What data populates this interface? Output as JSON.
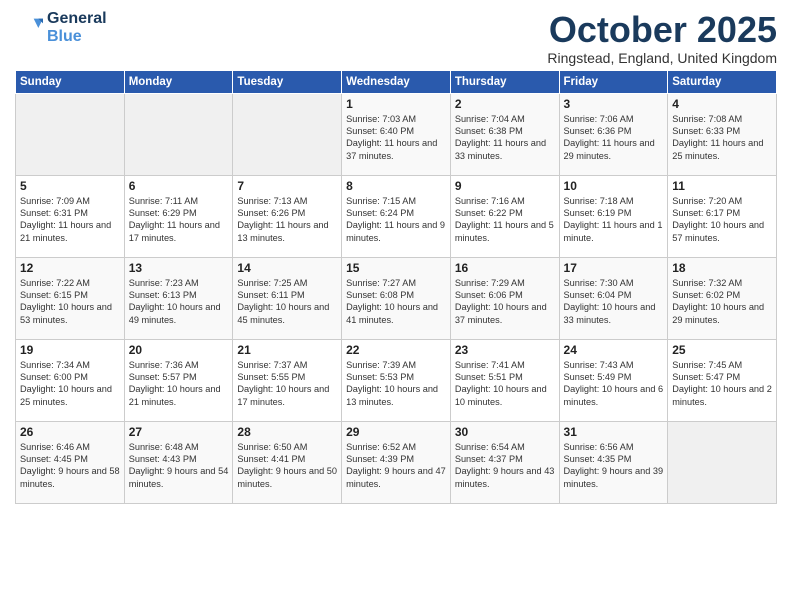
{
  "logo": {
    "line1": "General",
    "line2": "Blue"
  },
  "title": "October 2025",
  "location": "Ringstead, England, United Kingdom",
  "days_of_week": [
    "Sunday",
    "Monday",
    "Tuesday",
    "Wednesday",
    "Thursday",
    "Friday",
    "Saturday"
  ],
  "weeks": [
    [
      {
        "day": "",
        "empty": true
      },
      {
        "day": "",
        "empty": true
      },
      {
        "day": "",
        "empty": true
      },
      {
        "day": "1",
        "sunrise": "7:03 AM",
        "sunset": "6:40 PM",
        "daylight": "11 hours and 37 minutes."
      },
      {
        "day": "2",
        "sunrise": "7:04 AM",
        "sunset": "6:38 PM",
        "daylight": "11 hours and 33 minutes."
      },
      {
        "day": "3",
        "sunrise": "7:06 AM",
        "sunset": "6:36 PM",
        "daylight": "11 hours and 29 minutes."
      },
      {
        "day": "4",
        "sunrise": "7:08 AM",
        "sunset": "6:33 PM",
        "daylight": "11 hours and 25 minutes."
      }
    ],
    [
      {
        "day": "5",
        "sunrise": "7:09 AM",
        "sunset": "6:31 PM",
        "daylight": "11 hours and 21 minutes."
      },
      {
        "day": "6",
        "sunrise": "7:11 AM",
        "sunset": "6:29 PM",
        "daylight": "11 hours and 17 minutes."
      },
      {
        "day": "7",
        "sunrise": "7:13 AM",
        "sunset": "6:26 PM",
        "daylight": "11 hours and 13 minutes."
      },
      {
        "day": "8",
        "sunrise": "7:15 AM",
        "sunset": "6:24 PM",
        "daylight": "11 hours and 9 minutes."
      },
      {
        "day": "9",
        "sunrise": "7:16 AM",
        "sunset": "6:22 PM",
        "daylight": "11 hours and 5 minutes."
      },
      {
        "day": "10",
        "sunrise": "7:18 AM",
        "sunset": "6:19 PM",
        "daylight": "11 hours and 1 minute."
      },
      {
        "day": "11",
        "sunrise": "7:20 AM",
        "sunset": "6:17 PM",
        "daylight": "10 hours and 57 minutes."
      }
    ],
    [
      {
        "day": "12",
        "sunrise": "7:22 AM",
        "sunset": "6:15 PM",
        "daylight": "10 hours and 53 minutes."
      },
      {
        "day": "13",
        "sunrise": "7:23 AM",
        "sunset": "6:13 PM",
        "daylight": "10 hours and 49 minutes."
      },
      {
        "day": "14",
        "sunrise": "7:25 AM",
        "sunset": "6:11 PM",
        "daylight": "10 hours and 45 minutes."
      },
      {
        "day": "15",
        "sunrise": "7:27 AM",
        "sunset": "6:08 PM",
        "daylight": "10 hours and 41 minutes."
      },
      {
        "day": "16",
        "sunrise": "7:29 AM",
        "sunset": "6:06 PM",
        "daylight": "10 hours and 37 minutes."
      },
      {
        "day": "17",
        "sunrise": "7:30 AM",
        "sunset": "6:04 PM",
        "daylight": "10 hours and 33 minutes."
      },
      {
        "day": "18",
        "sunrise": "7:32 AM",
        "sunset": "6:02 PM",
        "daylight": "10 hours and 29 minutes."
      }
    ],
    [
      {
        "day": "19",
        "sunrise": "7:34 AM",
        "sunset": "6:00 PM",
        "daylight": "10 hours and 25 minutes."
      },
      {
        "day": "20",
        "sunrise": "7:36 AM",
        "sunset": "5:57 PM",
        "daylight": "10 hours and 21 minutes."
      },
      {
        "day": "21",
        "sunrise": "7:37 AM",
        "sunset": "5:55 PM",
        "daylight": "10 hours and 17 minutes."
      },
      {
        "day": "22",
        "sunrise": "7:39 AM",
        "sunset": "5:53 PM",
        "daylight": "10 hours and 13 minutes."
      },
      {
        "day": "23",
        "sunrise": "7:41 AM",
        "sunset": "5:51 PM",
        "daylight": "10 hours and 10 minutes."
      },
      {
        "day": "24",
        "sunrise": "7:43 AM",
        "sunset": "5:49 PM",
        "daylight": "10 hours and 6 minutes."
      },
      {
        "day": "25",
        "sunrise": "7:45 AM",
        "sunset": "5:47 PM",
        "daylight": "10 hours and 2 minutes."
      }
    ],
    [
      {
        "day": "26",
        "sunrise": "6:46 AM",
        "sunset": "4:45 PM",
        "daylight": "9 hours and 58 minutes."
      },
      {
        "day": "27",
        "sunrise": "6:48 AM",
        "sunset": "4:43 PM",
        "daylight": "9 hours and 54 minutes."
      },
      {
        "day": "28",
        "sunrise": "6:50 AM",
        "sunset": "4:41 PM",
        "daylight": "9 hours and 50 minutes."
      },
      {
        "day": "29",
        "sunrise": "6:52 AM",
        "sunset": "4:39 PM",
        "daylight": "9 hours and 47 minutes."
      },
      {
        "day": "30",
        "sunrise": "6:54 AM",
        "sunset": "4:37 PM",
        "daylight": "9 hours and 43 minutes."
      },
      {
        "day": "31",
        "sunrise": "6:56 AM",
        "sunset": "4:35 PM",
        "daylight": "9 hours and 39 minutes."
      },
      {
        "day": "",
        "empty": true
      }
    ]
  ]
}
